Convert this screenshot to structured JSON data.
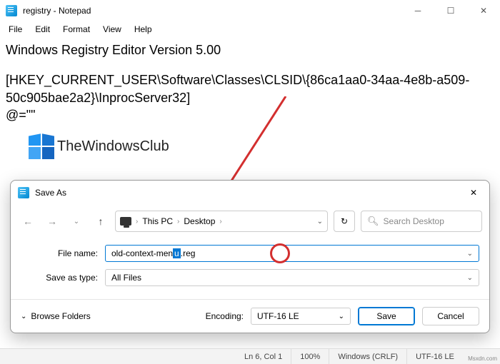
{
  "window": {
    "title": "registry - Notepad"
  },
  "menus": [
    "File",
    "Edit",
    "Format",
    "View",
    "Help"
  ],
  "editor": {
    "line1": "Windows Registry Editor Version 5.00",
    "line2": "[HKEY_CURRENT_USER\\Software\\Classes\\CLSID\\{86ca1aa0-34aa-4e8b-a509-50c905bae2a2}\\InprocServer32]",
    "line3": "@=\"\""
  },
  "watermark": {
    "text": "TheWindowsClub"
  },
  "dialog": {
    "title": "Save As",
    "breadcrumb": {
      "root": "This PC",
      "folder": "Desktop"
    },
    "search_placeholder": "Search Desktop",
    "filename_label": "File name:",
    "filename_base": "old-context-men",
    "filename_sel_char": "u",
    "filename_ext": ".reg",
    "saveastype_label": "Save as type:",
    "saveastype_value": "All Files",
    "browse_folders": "Browse Folders",
    "encoding_label": "Encoding:",
    "encoding_value": "UTF-16 LE",
    "save": "Save",
    "cancel": "Cancel"
  },
  "statusbar": {
    "position": "Ln 6, Col 1",
    "zoom": "100%",
    "eol": "Windows (CRLF)",
    "encoding": "UTF-16 LE"
  },
  "attribution": "Msxdn.com"
}
